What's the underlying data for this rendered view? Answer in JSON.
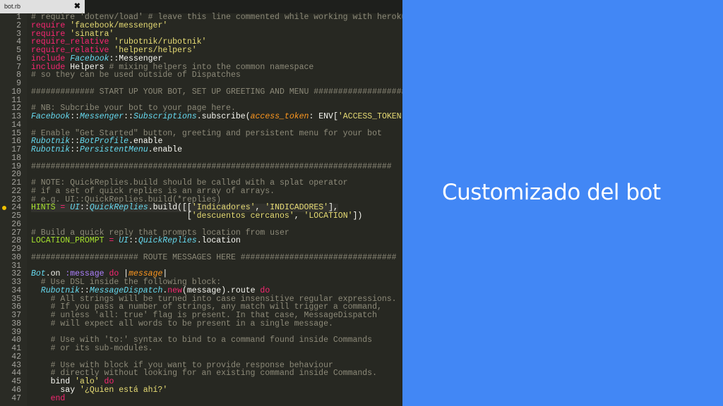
{
  "editor": {
    "tab_label": "bot.rb",
    "close_glyph": "✖",
    "active_line": 24,
    "lines": [
      [
        [
          "c",
          "# require 'dotenv/load' # leave this line commented while working with heroku"
        ]
      ],
      [
        [
          "k",
          "require "
        ],
        [
          "s",
          "'facebook/messenger'"
        ]
      ],
      [
        [
          "k",
          "require "
        ],
        [
          "s",
          "'sinatra'"
        ]
      ],
      [
        [
          "k",
          "require_relative "
        ],
        [
          "s",
          "'rubotnik/rubotnik'"
        ]
      ],
      [
        [
          "k",
          "require_relative "
        ],
        [
          "s",
          "'helpers/helpers'"
        ]
      ],
      [
        [
          "k",
          "include "
        ],
        [
          "t",
          "Facebook"
        ],
        [
          "p",
          "::Messenger"
        ]
      ],
      [
        [
          "k",
          "include "
        ],
        [
          "p",
          "Helpers "
        ],
        [
          "c",
          "# mixing helpers into the common namespace"
        ]
      ],
      [
        [
          "c",
          "# so they can be used outside of Dispatches"
        ]
      ],
      [
        [
          "p",
          ""
        ]
      ],
      [
        [
          "c",
          "############# START UP YOUR BOT, SET UP GREETING AND MENU ###################"
        ]
      ],
      [
        [
          "p",
          ""
        ]
      ],
      [
        [
          "c",
          "# NB: Subcribe your bot to your page here."
        ]
      ],
      [
        [
          "t",
          "Facebook"
        ],
        [
          "p",
          "::"
        ],
        [
          "t",
          "Messenger"
        ],
        [
          "p",
          "::"
        ],
        [
          "t",
          "Subscriptions"
        ],
        [
          "p",
          ".subscribe("
        ],
        [
          "a",
          "access_token"
        ],
        [
          "p",
          ": ENV["
        ],
        [
          "s",
          "'ACCESS_TOKEN'"
        ],
        [
          "p",
          "])"
        ]
      ],
      [
        [
          "p",
          ""
        ]
      ],
      [
        [
          "c",
          "# Enable \"Get Started\" button, greeting and persistent menu for your bot"
        ]
      ],
      [
        [
          "t",
          "Rubotnik"
        ],
        [
          "p",
          "::"
        ],
        [
          "t",
          "BotProfile"
        ],
        [
          "p",
          ".enable"
        ]
      ],
      [
        [
          "t",
          "Rubotnik"
        ],
        [
          "p",
          "::"
        ],
        [
          "t",
          "PersistentMenu"
        ],
        [
          "p",
          ".enable"
        ]
      ],
      [
        [
          "p",
          ""
        ]
      ],
      [
        [
          "c",
          "##########################################################################"
        ]
      ],
      [
        [
          "p",
          ""
        ]
      ],
      [
        [
          "c",
          "# NOTE: QuickReplies.build should be called with a splat operator"
        ]
      ],
      [
        [
          "c",
          "# if a set of quick replies is an array of arrays."
        ]
      ],
      [
        [
          "c",
          "# e.g. UI::QuickReplies.build(*replies)"
        ]
      ],
      [
        [
          "f",
          "HINTS"
        ],
        [
          "o",
          " = "
        ],
        [
          "t",
          "UI"
        ],
        [
          "p",
          "::"
        ],
        [
          "t",
          "QuickReplies"
        ],
        [
          "p",
          ".build(["
        ],
        [
          "p",
          "["
        ],
        [
          "s",
          "'Indicadores'"
        ],
        [
          "p",
          ", "
        ],
        [
          "s",
          "'INDICADORES'"
        ],
        [
          "p",
          "],"
        ]
      ],
      [
        [
          "p",
          "                                ["
        ],
        [
          "s",
          "'descuentos cercanos'"
        ],
        [
          "p",
          ", "
        ],
        [
          "s",
          "'LOCATION'"
        ],
        [
          "p",
          "])"
        ]
      ],
      [
        [
          "p",
          ""
        ]
      ],
      [
        [
          "c",
          "# Build a quick reply that prompts location from user"
        ]
      ],
      [
        [
          "f",
          "LOCATION_PROMPT"
        ],
        [
          "o",
          " = "
        ],
        [
          "t",
          "UI"
        ],
        [
          "p",
          "::"
        ],
        [
          "t",
          "QuickReplies"
        ],
        [
          "p",
          ".location"
        ]
      ],
      [
        [
          "p",
          ""
        ]
      ],
      [
        [
          "c",
          "###################### ROUTE MESSAGES HERE ################################"
        ]
      ],
      [
        [
          "p",
          ""
        ]
      ],
      [
        [
          "t",
          "Bot"
        ],
        [
          "p",
          ".on "
        ],
        [
          "v",
          ":message"
        ],
        [
          "k",
          " do "
        ],
        [
          "p",
          "|"
        ],
        [
          "a",
          "message"
        ],
        [
          "p",
          "|"
        ]
      ],
      [
        [
          "c",
          "  # Use DSL inside the following block:"
        ]
      ],
      [
        [
          "p",
          "  "
        ],
        [
          "t",
          "Rubotnik"
        ],
        [
          "p",
          "::"
        ],
        [
          "t",
          "MessageDispatch"
        ],
        [
          "p",
          "."
        ],
        [
          "k",
          "new"
        ],
        [
          "p",
          "(message).route "
        ],
        [
          "k",
          "do"
        ]
      ],
      [
        [
          "c",
          "    # All strings will be turned into case insensitive regular expressions."
        ]
      ],
      [
        [
          "c",
          "    # If you pass a number of strings, any match will trigger a command,"
        ]
      ],
      [
        [
          "c",
          "    # unless 'all: true' flag is present. In that case, MessageDispatch"
        ]
      ],
      [
        [
          "c",
          "    # will expect all words to be present in a single message."
        ]
      ],
      [
        [
          "p",
          ""
        ]
      ],
      [
        [
          "c",
          "    # Use with 'to:' syntax to bind to a command found inside Commands"
        ]
      ],
      [
        [
          "c",
          "    # or its sub-modules."
        ]
      ],
      [
        [
          "p",
          ""
        ]
      ],
      [
        [
          "c",
          "    # Use with block if you want to provide response behaviour"
        ]
      ],
      [
        [
          "c",
          "    # directly without looking for an existing command inside Commands."
        ]
      ],
      [
        [
          "p",
          "    bind "
        ],
        [
          "s",
          "'alo'"
        ],
        [
          "k",
          " do"
        ]
      ],
      [
        [
          "p",
          "      say "
        ],
        [
          "s",
          "'¿Quien está ahí?'"
        ]
      ],
      [
        [
          "k",
          "    end"
        ]
      ]
    ]
  },
  "slide": {
    "title": "Customizado del bot"
  },
  "colors": {
    "editor_bg": "#272822",
    "slide_bg": "#4287f5",
    "comment": "#8d8a79",
    "keyword": "#f92672",
    "string": "#e6db74",
    "type": "#66d9ef"
  }
}
